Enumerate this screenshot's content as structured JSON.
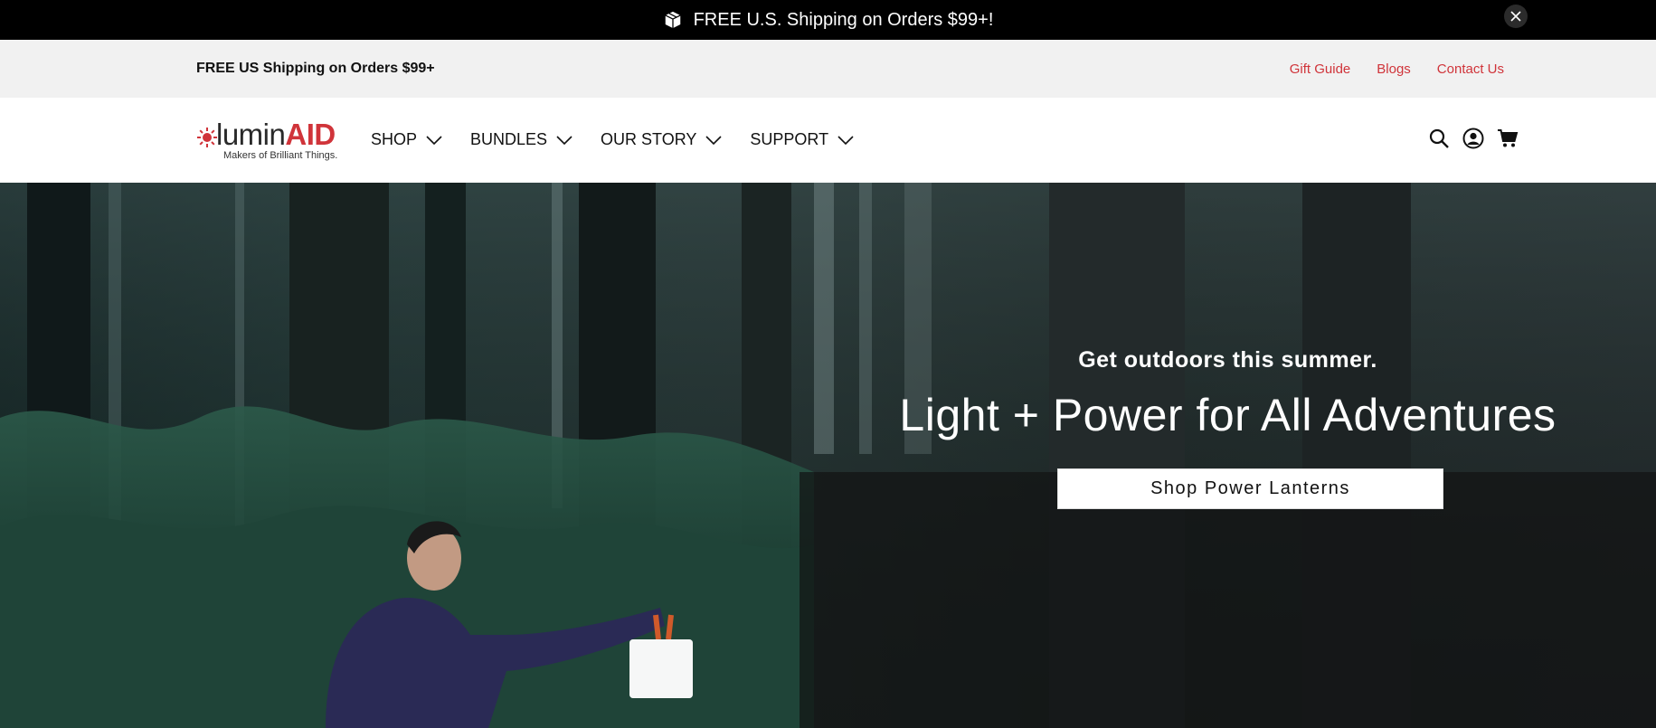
{
  "announcement": {
    "icon": "package-icon",
    "text": "FREE U.S. Shipping on Orders $99+!",
    "close_icon": "close-icon"
  },
  "utility": {
    "shipping_text": "FREE US Shipping on Orders $99+",
    "links": [
      {
        "label": "Gift Guide"
      },
      {
        "label": "Blogs"
      },
      {
        "label": "Contact Us"
      }
    ],
    "link_color": "#d0343a"
  },
  "header": {
    "logo": {
      "word_prefix": "lumin",
      "word_brand": "AID",
      "tagline": "Makers of Brilliant Things."
    },
    "nav": [
      {
        "label": "SHOP"
      },
      {
        "label": "BUNDLES"
      },
      {
        "label": "OUR STORY"
      },
      {
        "label": "SUPPORT"
      }
    ],
    "icons": [
      "search-icon",
      "account-icon",
      "cart-icon"
    ]
  },
  "hero": {
    "kicker": "Get outdoors this summer.",
    "title": "Light + Power for All Adventures",
    "cta": "Shop Power Lanterns"
  }
}
